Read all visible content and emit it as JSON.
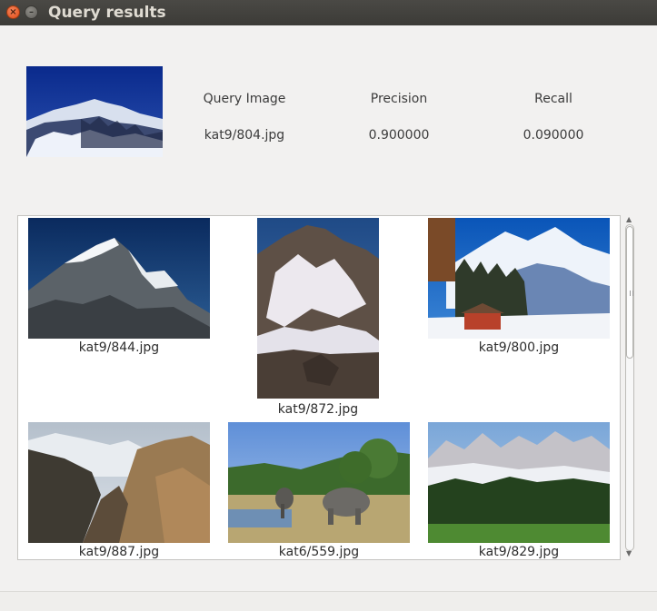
{
  "window": {
    "title": "Query results"
  },
  "header": {
    "columns": [
      "Query Image",
      "Precision",
      "Recall"
    ],
    "values": [
      "kat9/804.jpg",
      "0.900000",
      "0.090000"
    ]
  },
  "results": [
    {
      "caption": "kat9/844.jpg"
    },
    {
      "caption": "kat9/872.jpg"
    },
    {
      "caption": "kat9/800.jpg"
    },
    {
      "caption": "kat9/887.jpg"
    },
    {
      "caption": "kat6/559.jpg"
    },
    {
      "caption": "kat9/829.jpg"
    }
  ],
  "icons": {
    "close": "close-icon",
    "minimize": "minimize-icon"
  }
}
